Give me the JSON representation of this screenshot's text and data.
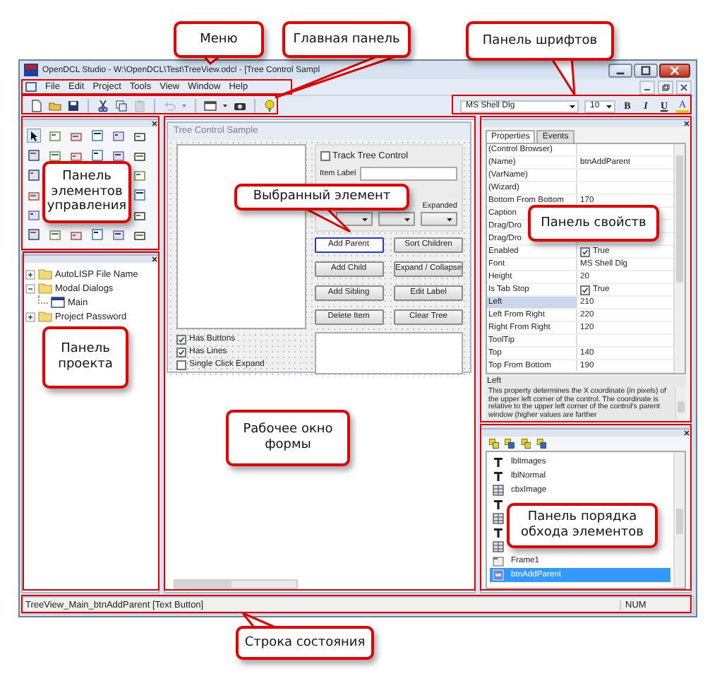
{
  "window": {
    "title": "OpenDCL Studio - W:\\OpenDCL\\Test\\TreeView.odcl - [Tree Control Sampl"
  },
  "menu": [
    "File",
    "Edit",
    "Project",
    "Tools",
    "View",
    "Window",
    "Help"
  ],
  "font_toolbar": {
    "font": "MS Shell Dlg",
    "size": "10",
    "style_buttons": [
      {
        "label": "B",
        "kind": "bold"
      },
      {
        "label": "I",
        "kind": "italic"
      },
      {
        "label": "U",
        "kind": "underline"
      },
      {
        "label": "A",
        "kind": "color"
      }
    ]
  },
  "project_tree": [
    {
      "label": "AutoLISP File Name",
      "kind": "folder",
      "expanded": false
    },
    {
      "label": "Modal Dialogs",
      "kind": "folder",
      "expanded": true,
      "children": [
        {
          "label": "Main",
          "kind": "dialog"
        }
      ]
    },
    {
      "label": "Project Password",
      "kind": "folder",
      "expanded": false
    }
  ],
  "form": {
    "title": "Tree Control Sample",
    "track": {
      "label": "Track Tree Control",
      "checked": false
    },
    "item_label": "Item Label",
    "expanded_label": "Expanded",
    "buttons": [
      {
        "label": "Add Parent",
        "selected": true
      },
      {
        "label": "Sort Children",
        "selected": false
      },
      {
        "label": "Add Child",
        "selected": false
      },
      {
        "label": "Expand / Collapse",
        "selected": false
      },
      {
        "label": "Add Sibling",
        "selected": false
      },
      {
        "label": "Edit Label",
        "selected": false
      },
      {
        "label": "Delete Item",
        "selected": false
      },
      {
        "label": "Clear Tree",
        "selected": false
      }
    ],
    "options": [
      {
        "label": "Has Buttons",
        "checked": true
      },
      {
        "label": "Has Lines",
        "checked": true
      },
      {
        "label": "Single Click Expand",
        "checked": false
      }
    ]
  },
  "properties": {
    "tabs": [
      {
        "label": "Properties",
        "selected": true
      },
      {
        "label": "Events",
        "selected": false
      }
    ],
    "rows": [
      {
        "name": "(Control Browser)",
        "kind": "text",
        "selected": false
      },
      {
        "name": "(Name)",
        "kind": "text",
        "value": "btnAddParent",
        "selected": false
      },
      {
        "name": "(VarName)",
        "kind": "text",
        "selected": false
      },
      {
        "name": "(Wizard)",
        "kind": "text",
        "selected": false
      },
      {
        "name": "Bottom From Bottom",
        "kind": "text",
        "value": "170",
        "selected": false
      },
      {
        "name": "Caption",
        "kind": "text",
        "selected": false
      },
      {
        "name": "Drag/Dro",
        "kind": "text",
        "selected": false
      },
      {
        "name": "Drag/Dro",
        "kind": "text",
        "selected": false
      },
      {
        "name": "Enabled",
        "kind": "check",
        "checked": true,
        "value": "True",
        "selected": false
      },
      {
        "name": "Font",
        "kind": "text",
        "value": "MS Shell Dlg",
        "selected": false
      },
      {
        "name": "Height",
        "kind": "text",
        "value": "20",
        "selected": false
      },
      {
        "name": "Is Tab Stop",
        "kind": "check",
        "checked": true,
        "value": "True",
        "selected": false
      },
      {
        "name": "Left",
        "kind": "text",
        "value": "210",
        "selected": true
      },
      {
        "name": "Left From Right",
        "kind": "text",
        "value": "220",
        "selected": false
      },
      {
        "name": "Right From Right",
        "kind": "text",
        "value": "120",
        "selected": false
      },
      {
        "name": "ToolTip",
        "kind": "text",
        "selected": false
      },
      {
        "name": "Top",
        "kind": "text",
        "value": "140",
        "selected": false
      },
      {
        "name": "Top From Bottom",
        "kind": "text",
        "value": "190",
        "selected": false
      }
    ],
    "description": {
      "title": "Left",
      "text": "This property determines the X coordinate (in pixels) of the upper left corner of the control. The coordinate is relative to the upper left corner of the control's parent window (higher values are farther"
    }
  },
  "tab_order": {
    "items": [
      {
        "kind": "label",
        "name": "lblImages",
        "selected": false
      },
      {
        "kind": "label",
        "name": "lblNormal",
        "selected": false
      },
      {
        "kind": "image",
        "name": "cbxImage",
        "selected": false
      },
      {
        "kind": "label",
        "selected": false
      },
      {
        "kind": "image",
        "selected": false
      },
      {
        "kind": "label",
        "selected": false
      },
      {
        "kind": "image",
        "selected": false
      },
      {
        "kind": "frame",
        "name": "Frame1",
        "selected": false
      },
      {
        "kind": "button",
        "name": "btnAddParent",
        "selected": true
      }
    ]
  },
  "status_bar": {
    "text": "TreeView_Main_btnAddParent [Text Button]",
    "indicator": "NUM"
  },
  "callouts": [
    "Меню",
    "Главная панель",
    "Панель шрифтов",
    "Панель элементов управления",
    "Панель проекта",
    "Выбранный элемент",
    "Рабочее окно формы",
    "Панель свойств",
    "Панель порядка обхода элементов",
    "Строка состояния"
  ]
}
